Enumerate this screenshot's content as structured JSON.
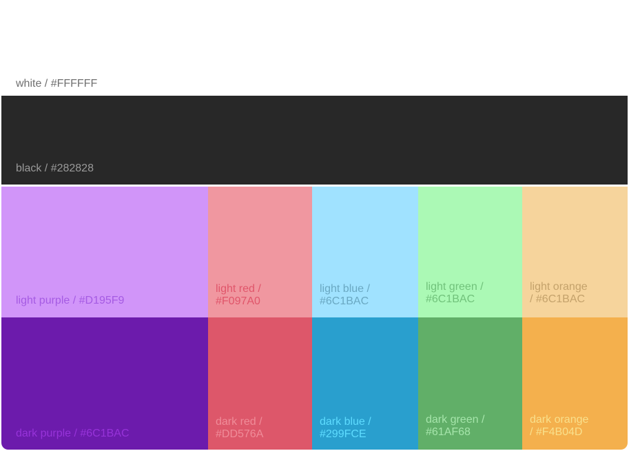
{
  "colors": {
    "white": "#FFFFFF",
    "black": "#282828",
    "light_purple": "#D195F9",
    "light_red": "#F097A0",
    "light_blue": "#A0E2FF",
    "light_green": "#ABF9B5",
    "light_orange": "#F6D49C",
    "dark_purple": "#6C1BAC",
    "dark_red": "#DD576A",
    "dark_blue": "#299FCE",
    "dark_green": "#61AF68",
    "dark_orange": "#F4B04D"
  },
  "swatches": {
    "white": {
      "label": "white / #FFFFFF"
    },
    "black": {
      "label": "black / #282828"
    },
    "light_purple": {
      "label": "light purple / #D195F9"
    },
    "light_red": {
      "line1": "light red /",
      "line2": "#F097A0"
    },
    "light_blue": {
      "line1": "light blue /",
      "line2": "#6C1BAC"
    },
    "light_green": {
      "line1": "light green /",
      "line2": "#6C1BAC"
    },
    "light_orange": {
      "line1": "light orange",
      "line2": "/ #6C1BAC"
    },
    "dark_purple": {
      "label": "dark purple / #6C1BAC"
    },
    "dark_red": {
      "line1": "dark red /",
      "line2": "#DD576A"
    },
    "dark_blue": {
      "line1": "dark blue /",
      "line2": "#299FCE"
    },
    "dark_green": {
      "line1": "dark green /",
      "line2": "#61AF68"
    },
    "dark_orange": {
      "line1": "dark orange",
      "line2": "/ #F4B04D"
    }
  }
}
